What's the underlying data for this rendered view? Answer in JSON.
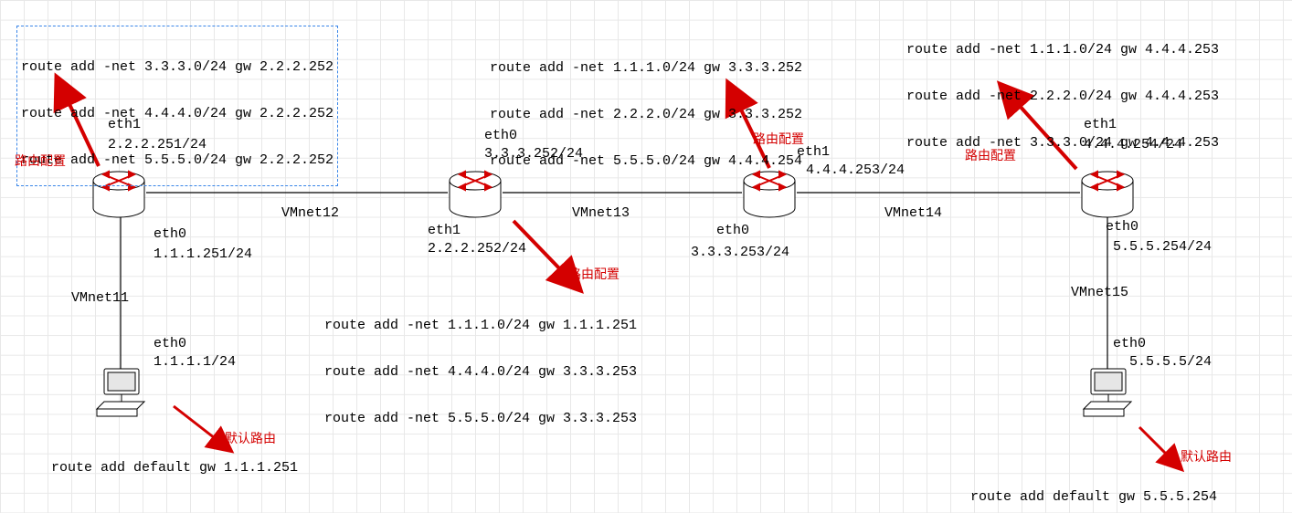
{
  "routeBoxes": {
    "r1": {
      "l1": "route add -net 3.3.3.0/24 gw 2.2.2.252",
      "l2": "route add -net 4.4.4.0/24 gw 2.2.2.252",
      "l3": "route add -net 5.5.5.0/24 gw 2.2.2.252"
    },
    "r2": {
      "l1": "route add -net 1.1.1.0/24 gw 1.1.1.251",
      "l2": "route add -net 4.4.4.0/24 gw 3.3.3.253",
      "l3": "route add -net 5.5.5.0/24 gw 3.3.3.253"
    },
    "r3": {
      "l1": "route add -net 1.1.1.0/24 gw 3.3.3.252",
      "l2": "route add -net 2.2.2.0/24 gw 3.3.3.252",
      "l3": "route add -net 5.5.5.0/24 gw 4.4.4.254"
    },
    "r4": {
      "l1": "route add -net 1.1.1.0/24 gw 4.4.4.253",
      "l2": "route add -net 2.2.2.0/24 gw 4.4.4.253",
      "l3": "route add -net 3.3.3.0/24 gw 4.4.4.253"
    }
  },
  "hosts": {
    "h1": {
      "eth": "eth0",
      "ip": "1.1.1.1/24",
      "defroute": "route add default gw 1.1.1.251"
    },
    "h2": {
      "eth": "eth0",
      "ip": "5.5.5.5/24",
      "defroute": "route add default gw 5.5.5.254"
    }
  },
  "routers": {
    "R1": {
      "if_top": "eth1",
      "ip_top": "2.2.2.251/24",
      "if_bot": "eth0",
      "ip_bot": "1.1.1.251/24"
    },
    "R2": {
      "if_top": "eth0",
      "ip_top": "3.3.3.252/24",
      "if_bot": "eth1",
      "ip_bot": "2.2.2.252/24"
    },
    "R3": {
      "if_top": "eth1",
      "ip_top": "4.4.4.253/24",
      "if_bot": "eth0",
      "ip_bot": "3.3.3.253/24"
    },
    "R4": {
      "if_top": "eth1",
      "ip_top": "4.4.4.254/24",
      "if_bot": "eth0",
      "ip_bot": "5.5.5.254/24"
    }
  },
  "links": {
    "vmnet11": "VMnet11",
    "vmnet12": "VMnet12",
    "vmnet13": "VMnet13",
    "vmnet14": "VMnet14",
    "vmnet15": "VMnet15"
  },
  "labels": {
    "route_cfg": "路由配置",
    "default_route": "默认路由"
  }
}
